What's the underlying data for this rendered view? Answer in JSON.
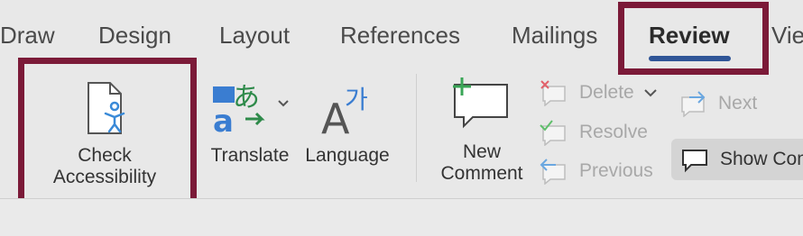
{
  "tabs": {
    "draw": "Draw",
    "design": "Design",
    "layout": "Layout",
    "references": "References",
    "mailings": "Mailings",
    "review": "Review",
    "view_partial": "Vie"
  },
  "ribbon": {
    "check_accessibility_line1": "Check",
    "check_accessibility_line2": "Accessibility",
    "translate": "Translate",
    "language": "Language",
    "new_comment_line1": "New",
    "new_comment_line2": "Comment",
    "delete": "Delete",
    "resolve": "Resolve",
    "previous": "Previous",
    "next": "Next",
    "show_comments_partial": "Show Com"
  },
  "icons": {
    "language_glyph_a": "A",
    "language_glyph_ko": "가",
    "translate_glyph_ja": "あ",
    "translate_glyph_a": "a"
  },
  "colors": {
    "highlight": "#7b1a38",
    "active_tab_underline": "#2f5597",
    "accessibility_blue": "#3a8ad8",
    "new_comment_plus": "#3aa657",
    "delete_red": "#e2606a",
    "resolve_green": "#5fbf6b",
    "nav_blue": "#6aa7e0"
  }
}
